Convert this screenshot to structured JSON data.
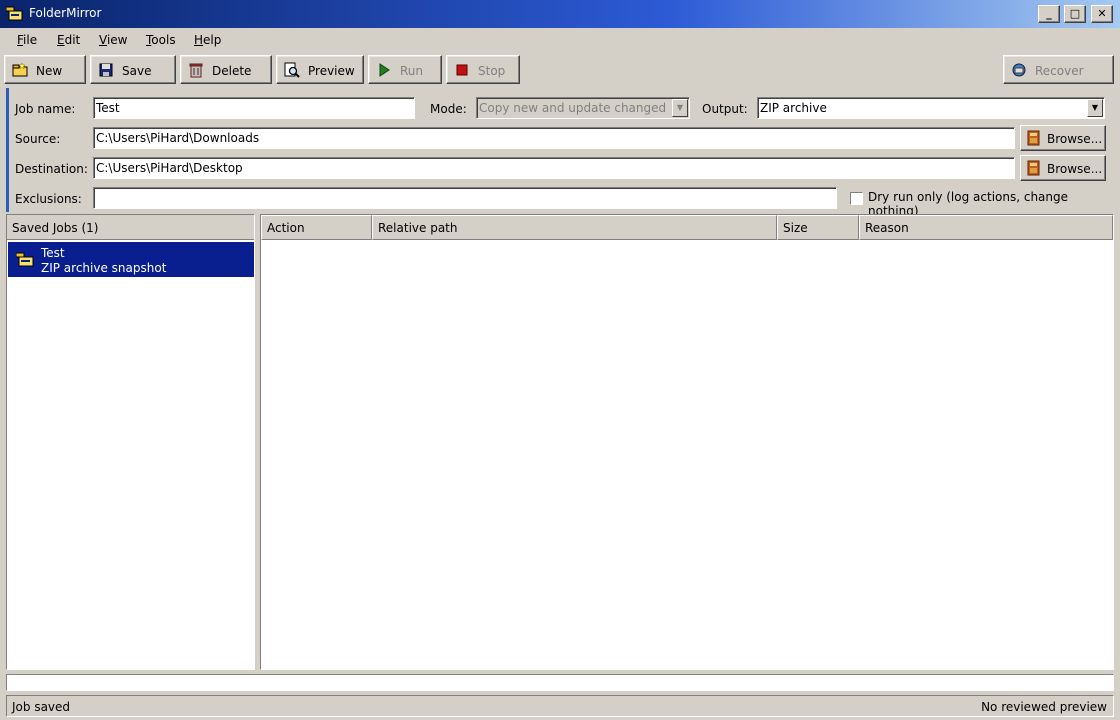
{
  "window": {
    "title": "FolderMirror",
    "minimize": "_",
    "maximize": "□",
    "close": "✕"
  },
  "menu": [
    {
      "label": "File",
      "mnemonic": "F",
      "rest": "ile"
    },
    {
      "label": "Edit",
      "mnemonic": "E",
      "rest": "dit"
    },
    {
      "label": "View",
      "mnemonic": "V",
      "rest": "iew"
    },
    {
      "label": "Tools",
      "mnemonic": "T",
      "rest": "ools"
    },
    {
      "label": "Help",
      "mnemonic": "H",
      "rest": "elp"
    }
  ],
  "toolbar": {
    "new": "New",
    "save": "Save",
    "delete": "Delete",
    "preview": "Preview",
    "run": "Run",
    "stop": "Stop",
    "recover": "Recover"
  },
  "form": {
    "job_name_label": "Job name:",
    "job_name_value": "Test",
    "mode_label": "Mode:",
    "mode_value": "Copy new and update changed",
    "output_label": "Output:",
    "output_value": "ZIP archive",
    "source_label": "Source:",
    "source_value": "C:\\Users\\PiHard\\Downloads",
    "destination_label": "Destination:",
    "destination_value": "C:\\Users\\PiHard\\Desktop",
    "exclusions_label": "Exclusions:",
    "exclusions_value": "",
    "browse_label": "Browse...",
    "dry_run_label": "Dry run only (log actions, change nothing)",
    "dry_run_checked": false
  },
  "saved_jobs": {
    "header": "Saved Jobs (1)",
    "items": [
      {
        "name": "Test",
        "description": "ZIP archive snapshot"
      }
    ]
  },
  "results_table": {
    "columns": [
      "Action",
      "Relative path",
      "Size",
      "Reason"
    ],
    "rows": []
  },
  "status": {
    "left": "Job saved",
    "right": "No reviewed preview"
  },
  "colors": {
    "accent": "#0a246a",
    "selection": "#0a1f8f",
    "face": "#d4d0c8"
  }
}
